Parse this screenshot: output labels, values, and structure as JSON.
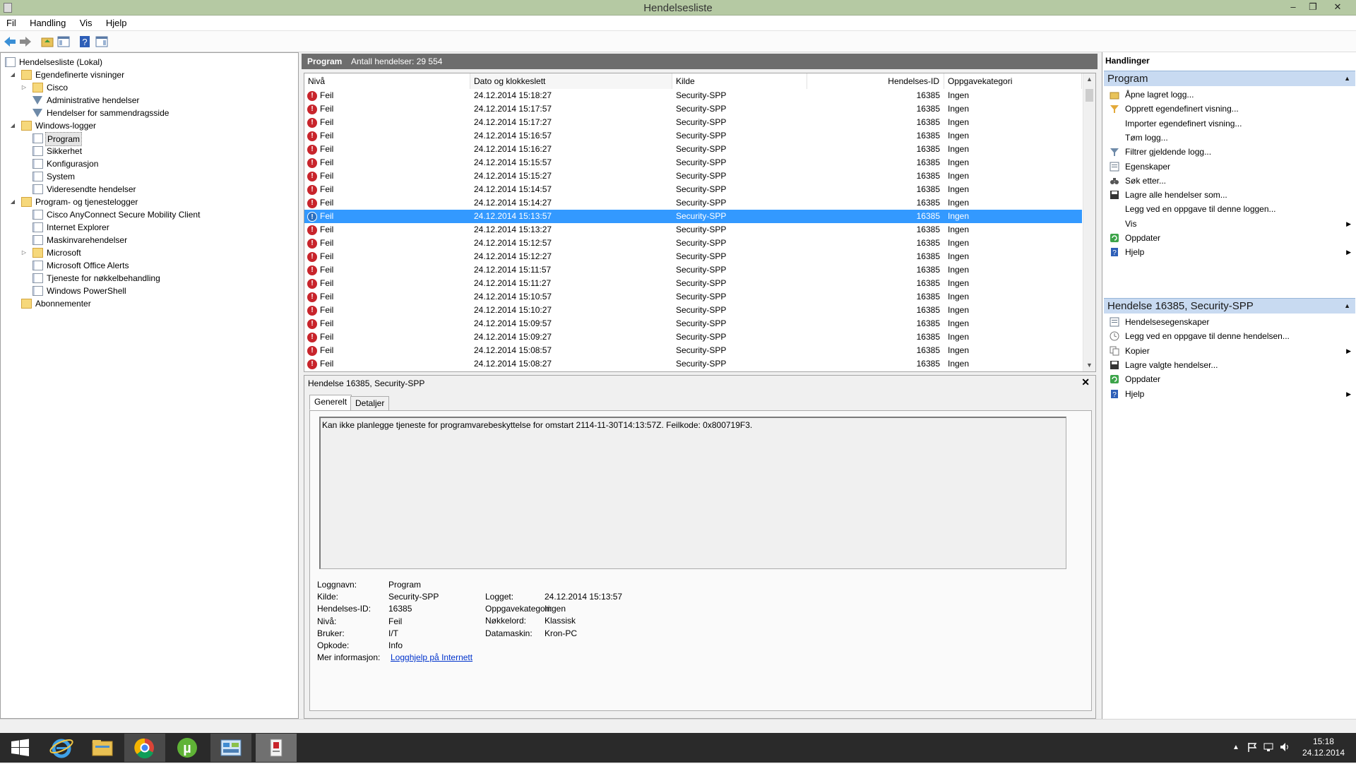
{
  "window": {
    "title": "Hendelsesliste",
    "controls": [
      "–",
      "❐",
      "✕"
    ]
  },
  "menu": [
    "Fil",
    "Handling",
    "Vis",
    "Hjelp"
  ],
  "toolbar": [
    "back-icon",
    "forward-icon",
    "up-folder-icon",
    "show-hide-tree-icon",
    "help-icon",
    "show-hide-action-icon"
  ],
  "tree": [
    {
      "label": "Hendelsesliste (Lokal)",
      "level": 0,
      "icon": "computer-log-icon",
      "expander": ""
    },
    {
      "label": "Egendefinerte visninger",
      "level": 1,
      "icon": "folder-icon",
      "expander": "◢"
    },
    {
      "label": "Cisco",
      "level": 2,
      "icon": "folder-icon",
      "expander": "▷"
    },
    {
      "label": "Administrative hendelser",
      "level": 2,
      "icon": "filter-icon",
      "expander": ""
    },
    {
      "label": "Hendelser for sammendragsside",
      "level": 2,
      "icon": "filter-icon",
      "expander": ""
    },
    {
      "label": "Windows-logger",
      "level": 1,
      "icon": "folder-icon",
      "expander": "◢"
    },
    {
      "label": "Program",
      "level": 2,
      "icon": "log-icon",
      "expander": "",
      "selected": true
    },
    {
      "label": "Sikkerhet",
      "level": 2,
      "icon": "log-icon",
      "expander": ""
    },
    {
      "label": "Konfigurasjon",
      "level": 2,
      "icon": "log-icon",
      "expander": ""
    },
    {
      "label": "System",
      "level": 2,
      "icon": "log-icon",
      "expander": ""
    },
    {
      "label": "Videresendte hendelser",
      "level": 2,
      "icon": "log-icon",
      "expander": ""
    },
    {
      "label": "Program- og tjenestelogger",
      "level": 1,
      "icon": "folder-icon",
      "expander": "◢"
    },
    {
      "label": "Cisco AnyConnect Secure Mobility Client",
      "level": 2,
      "icon": "log-icon",
      "expander": ""
    },
    {
      "label": "Internet Explorer",
      "level": 2,
      "icon": "log-icon",
      "expander": ""
    },
    {
      "label": "Maskinvarehendelser",
      "level": 2,
      "icon": "log-icon",
      "expander": ""
    },
    {
      "label": "Microsoft",
      "level": 2,
      "icon": "folder-icon",
      "expander": "▷"
    },
    {
      "label": "Microsoft Office Alerts",
      "level": 2,
      "icon": "log-icon",
      "expander": ""
    },
    {
      "label": "Tjeneste for nøkkelbehandling",
      "level": 2,
      "icon": "log-icon",
      "expander": ""
    },
    {
      "label": "Windows PowerShell",
      "level": 2,
      "icon": "log-icon",
      "expander": ""
    },
    {
      "label": "Abonnementer",
      "level": 1,
      "icon": "folder-icon",
      "expander": ""
    }
  ],
  "list": {
    "name": "Program",
    "count": "Antall hendelser: 29 554",
    "columns": [
      "Nivå",
      "Dato og klokkeslett",
      "Kilde",
      "Hendelses-ID",
      "Oppgavekategori"
    ],
    "rows": [
      {
        "level": "Feil",
        "date": "24.12.2014 15:18:27",
        "source": "Security-SPP",
        "id": "16385",
        "category": "Ingen"
      },
      {
        "level": "Feil",
        "date": "24.12.2014 15:17:57",
        "source": "Security-SPP",
        "id": "16385",
        "category": "Ingen"
      },
      {
        "level": "Feil",
        "date": "24.12.2014 15:17:27",
        "source": "Security-SPP",
        "id": "16385",
        "category": "Ingen"
      },
      {
        "level": "Feil",
        "date": "24.12.2014 15:16:57",
        "source": "Security-SPP",
        "id": "16385",
        "category": "Ingen"
      },
      {
        "level": "Feil",
        "date": "24.12.2014 15:16:27",
        "source": "Security-SPP",
        "id": "16385",
        "category": "Ingen"
      },
      {
        "level": "Feil",
        "date": "24.12.2014 15:15:57",
        "source": "Security-SPP",
        "id": "16385",
        "category": "Ingen"
      },
      {
        "level": "Feil",
        "date": "24.12.2014 15:15:27",
        "source": "Security-SPP",
        "id": "16385",
        "category": "Ingen"
      },
      {
        "level": "Feil",
        "date": "24.12.2014 15:14:57",
        "source": "Security-SPP",
        "id": "16385",
        "category": "Ingen"
      },
      {
        "level": "Feil",
        "date": "24.12.2014 15:14:27",
        "source": "Security-SPP",
        "id": "16385",
        "category": "Ingen"
      },
      {
        "level": "Feil",
        "date": "24.12.2014 15:13:57",
        "source": "Security-SPP",
        "id": "16385",
        "category": "Ingen",
        "selected": true
      },
      {
        "level": "Feil",
        "date": "24.12.2014 15:13:27",
        "source": "Security-SPP",
        "id": "16385",
        "category": "Ingen"
      },
      {
        "level": "Feil",
        "date": "24.12.2014 15:12:57",
        "source": "Security-SPP",
        "id": "16385",
        "category": "Ingen"
      },
      {
        "level": "Feil",
        "date": "24.12.2014 15:12:27",
        "source": "Security-SPP",
        "id": "16385",
        "category": "Ingen"
      },
      {
        "level": "Feil",
        "date": "24.12.2014 15:11:57",
        "source": "Security-SPP",
        "id": "16385",
        "category": "Ingen"
      },
      {
        "level": "Feil",
        "date": "24.12.2014 15:11:27",
        "source": "Security-SPP",
        "id": "16385",
        "category": "Ingen"
      },
      {
        "level": "Feil",
        "date": "24.12.2014 15:10:57",
        "source": "Security-SPP",
        "id": "16385",
        "category": "Ingen"
      },
      {
        "level": "Feil",
        "date": "24.12.2014 15:10:27",
        "source": "Security-SPP",
        "id": "16385",
        "category": "Ingen"
      },
      {
        "level": "Feil",
        "date": "24.12.2014 15:09:57",
        "source": "Security-SPP",
        "id": "16385",
        "category": "Ingen"
      },
      {
        "level": "Feil",
        "date": "24.12.2014 15:09:27",
        "source": "Security-SPP",
        "id": "16385",
        "category": "Ingen"
      },
      {
        "level": "Feil",
        "date": "24.12.2014 15:08:57",
        "source": "Security-SPP",
        "id": "16385",
        "category": "Ingen"
      },
      {
        "level": "Feil",
        "date": "24.12.2014 15:08:27",
        "source": "Security-SPP",
        "id": "16385",
        "category": "Ingen"
      }
    ]
  },
  "detail": {
    "title": "Hendelse 16385, Security-SPP",
    "tabs": [
      "Generelt",
      "Detaljer"
    ],
    "message": "Kan ikke planlegge tjeneste for programvarebeskyttelse for omstart 2114-11-30T14:13:57Z. Feilkode: 0x800719F3.",
    "left_fields": [
      {
        "label": "Loggnavn:",
        "value": "Program"
      },
      {
        "label": "Kilde:",
        "value": "Security-SPP"
      },
      {
        "label": "Hendelses-ID:",
        "value": "16385"
      },
      {
        "label": "Nivå:",
        "value": "Feil"
      },
      {
        "label": "Bruker:",
        "value": "I/T"
      },
      {
        "label": "Opkode:",
        "value": "Info"
      }
    ],
    "right_fields": [
      {
        "label": "Logget:",
        "value": "24.12.2014 15:13:57"
      },
      {
        "label": "Oppgavekategori:",
        "value": "Ingen"
      },
      {
        "label": "Nøkkelord:",
        "value": "Klassisk"
      },
      {
        "label": "Datamaskin:",
        "value": "Kron-PC"
      }
    ],
    "more_info_label": "Mer informasjon:",
    "more_info_link": "Logghjelp på Internett"
  },
  "actions": {
    "header": "Handlinger",
    "section1": "Program",
    "items1": [
      {
        "label": "Åpne lagret logg...",
        "icon": "open-folder-icon"
      },
      {
        "label": "Opprett egendefinert visning...",
        "icon": "filter-add-icon"
      },
      {
        "label": "Importer egendefinert visning...",
        "icon": ""
      },
      {
        "label": "Tøm logg...",
        "icon": ""
      },
      {
        "label": "Filtrer gjeldende logg...",
        "icon": "filter-icon"
      },
      {
        "label": "Egenskaper",
        "icon": "properties-icon"
      },
      {
        "label": "Søk etter...",
        "icon": "binoculars-icon"
      },
      {
        "label": "Lagre alle hendelser som...",
        "icon": "save-icon"
      },
      {
        "label": "Legg ved en oppgave til denne loggen...",
        "icon": ""
      },
      {
        "label": "Vis",
        "icon": "",
        "submenu": "▶"
      },
      {
        "label": "Oppdater",
        "icon": "refresh-icon"
      },
      {
        "label": "Hjelp",
        "icon": "help-icon",
        "submenu": "▶"
      }
    ],
    "section2": "Hendelse 16385, Security-SPP",
    "items2": [
      {
        "label": "Hendelsesegenskaper",
        "icon": "properties-icon"
      },
      {
        "label": "Legg ved en oppgave til denne hendelsen...",
        "icon": "task-icon"
      },
      {
        "label": "Kopier",
        "icon": "copy-icon",
        "submenu": "▶"
      },
      {
        "label": "Lagre valgte hendelser...",
        "icon": "save-icon"
      },
      {
        "label": "Oppdater",
        "icon": "refresh-icon"
      },
      {
        "label": "Hjelp",
        "icon": "help-icon",
        "submenu": "▶"
      }
    ]
  },
  "taskbar": {
    "apps": [
      "windows-start-icon",
      "internet-explorer-icon",
      "file-explorer-icon",
      "chrome-icon",
      "utorrent-icon",
      "control-panel-icon",
      "event-viewer-icon"
    ],
    "tray": [
      "▲",
      "flag-icon",
      "network-icon",
      "volume-icon"
    ],
    "time": "15:18",
    "date": "24.12.2014"
  },
  "colors": {
    "titlebar": "#b5c9a3",
    "selection": "#3399ff",
    "section": "#c8daf1",
    "error": "#c8242b",
    "taskbar": "#2a2a2a"
  }
}
